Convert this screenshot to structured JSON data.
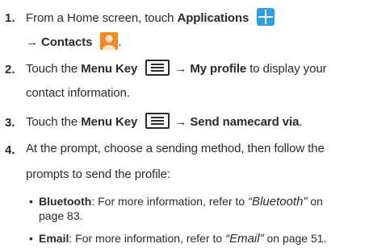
{
  "steps": [
    {
      "num": "1.",
      "a": "From a Home screen, touch ",
      "b": "Applications",
      "c": "→ Contacts"
    },
    {
      "num": "2.",
      "a": "Touch the ",
      "b": "Menu Key",
      "c": "→ My profile",
      "d": " to display your",
      "e": "contact information."
    },
    {
      "num": "3.",
      "a": "Touch the ",
      "b": "Menu Key",
      "c": "→ Send namecard via",
      "d": "."
    },
    {
      "num": "4.",
      "a": "At the prompt, choose a sending method, then follow the",
      "e": "prompts to send the profile:"
    }
  ],
  "bullets": [
    {
      "term": "Bluetooth",
      "text": ": For more information, refer to ",
      "ref": "“Bluetooth”",
      "after": " on",
      "cont": "page 83."
    },
    {
      "term": "Email",
      "text": ": For more information, refer to ",
      "ref": "“Email”",
      "after": " on page 51."
    }
  ],
  "icons": [
    "applications-icon",
    "contacts-icon",
    "menu-key-icon"
  ],
  "colors": {
    "applications_icon": "#2b9fe0",
    "contacts_icon": "#f08a24"
  }
}
